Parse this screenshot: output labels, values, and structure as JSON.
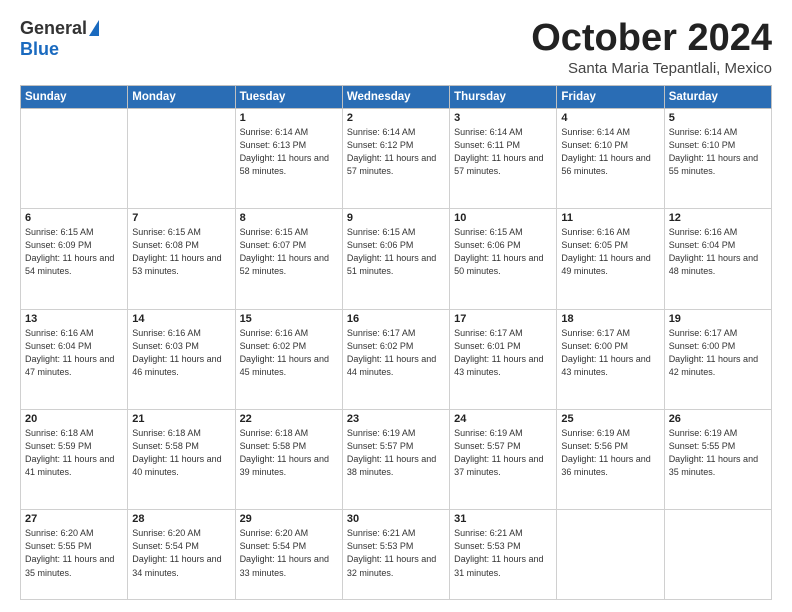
{
  "header": {
    "logo_general": "General",
    "logo_blue": "Blue",
    "month_title": "October 2024",
    "subtitle": "Santa Maria Tepantlali, Mexico"
  },
  "days_of_week": [
    "Sunday",
    "Monday",
    "Tuesday",
    "Wednesday",
    "Thursday",
    "Friday",
    "Saturday"
  ],
  "weeks": [
    [
      {
        "day": "",
        "empty": true
      },
      {
        "day": "",
        "empty": true
      },
      {
        "day": "1",
        "sunrise": "6:14 AM",
        "sunset": "6:13 PM",
        "daylight": "11 hours and 58 minutes."
      },
      {
        "day": "2",
        "sunrise": "6:14 AM",
        "sunset": "6:12 PM",
        "daylight": "11 hours and 57 minutes."
      },
      {
        "day": "3",
        "sunrise": "6:14 AM",
        "sunset": "6:11 PM",
        "daylight": "11 hours and 57 minutes."
      },
      {
        "day": "4",
        "sunrise": "6:14 AM",
        "sunset": "6:10 PM",
        "daylight": "11 hours and 56 minutes."
      },
      {
        "day": "5",
        "sunrise": "6:14 AM",
        "sunset": "6:10 PM",
        "daylight": "11 hours and 55 minutes."
      }
    ],
    [
      {
        "day": "6",
        "sunrise": "6:15 AM",
        "sunset": "6:09 PM",
        "daylight": "11 hours and 54 minutes."
      },
      {
        "day": "7",
        "sunrise": "6:15 AM",
        "sunset": "6:08 PM",
        "daylight": "11 hours and 53 minutes."
      },
      {
        "day": "8",
        "sunrise": "6:15 AM",
        "sunset": "6:07 PM",
        "daylight": "11 hours and 52 minutes."
      },
      {
        "day": "9",
        "sunrise": "6:15 AM",
        "sunset": "6:06 PM",
        "daylight": "11 hours and 51 minutes."
      },
      {
        "day": "10",
        "sunrise": "6:15 AM",
        "sunset": "6:06 PM",
        "daylight": "11 hours and 50 minutes."
      },
      {
        "day": "11",
        "sunrise": "6:16 AM",
        "sunset": "6:05 PM",
        "daylight": "11 hours and 49 minutes."
      },
      {
        "day": "12",
        "sunrise": "6:16 AM",
        "sunset": "6:04 PM",
        "daylight": "11 hours and 48 minutes."
      }
    ],
    [
      {
        "day": "13",
        "sunrise": "6:16 AM",
        "sunset": "6:04 PM",
        "daylight": "11 hours and 47 minutes."
      },
      {
        "day": "14",
        "sunrise": "6:16 AM",
        "sunset": "6:03 PM",
        "daylight": "11 hours and 46 minutes."
      },
      {
        "day": "15",
        "sunrise": "6:16 AM",
        "sunset": "6:02 PM",
        "daylight": "11 hours and 45 minutes."
      },
      {
        "day": "16",
        "sunrise": "6:17 AM",
        "sunset": "6:02 PM",
        "daylight": "11 hours and 44 minutes."
      },
      {
        "day": "17",
        "sunrise": "6:17 AM",
        "sunset": "6:01 PM",
        "daylight": "11 hours and 43 minutes."
      },
      {
        "day": "18",
        "sunrise": "6:17 AM",
        "sunset": "6:00 PM",
        "daylight": "11 hours and 43 minutes."
      },
      {
        "day": "19",
        "sunrise": "6:17 AM",
        "sunset": "6:00 PM",
        "daylight": "11 hours and 42 minutes."
      }
    ],
    [
      {
        "day": "20",
        "sunrise": "6:18 AM",
        "sunset": "5:59 PM",
        "daylight": "11 hours and 41 minutes."
      },
      {
        "day": "21",
        "sunrise": "6:18 AM",
        "sunset": "5:58 PM",
        "daylight": "11 hours and 40 minutes."
      },
      {
        "day": "22",
        "sunrise": "6:18 AM",
        "sunset": "5:58 PM",
        "daylight": "11 hours and 39 minutes."
      },
      {
        "day": "23",
        "sunrise": "6:19 AM",
        "sunset": "5:57 PM",
        "daylight": "11 hours and 38 minutes."
      },
      {
        "day": "24",
        "sunrise": "6:19 AM",
        "sunset": "5:57 PM",
        "daylight": "11 hours and 37 minutes."
      },
      {
        "day": "25",
        "sunrise": "6:19 AM",
        "sunset": "5:56 PM",
        "daylight": "11 hours and 36 minutes."
      },
      {
        "day": "26",
        "sunrise": "6:19 AM",
        "sunset": "5:55 PM",
        "daylight": "11 hours and 35 minutes."
      }
    ],
    [
      {
        "day": "27",
        "sunrise": "6:20 AM",
        "sunset": "5:55 PM",
        "daylight": "11 hours and 35 minutes."
      },
      {
        "day": "28",
        "sunrise": "6:20 AM",
        "sunset": "5:54 PM",
        "daylight": "11 hours and 34 minutes."
      },
      {
        "day": "29",
        "sunrise": "6:20 AM",
        "sunset": "5:54 PM",
        "daylight": "11 hours and 33 minutes."
      },
      {
        "day": "30",
        "sunrise": "6:21 AM",
        "sunset": "5:53 PM",
        "daylight": "11 hours and 32 minutes."
      },
      {
        "day": "31",
        "sunrise": "6:21 AM",
        "sunset": "5:53 PM",
        "daylight": "11 hours and 31 minutes."
      },
      {
        "day": "",
        "empty": true
      },
      {
        "day": "",
        "empty": true
      }
    ]
  ]
}
